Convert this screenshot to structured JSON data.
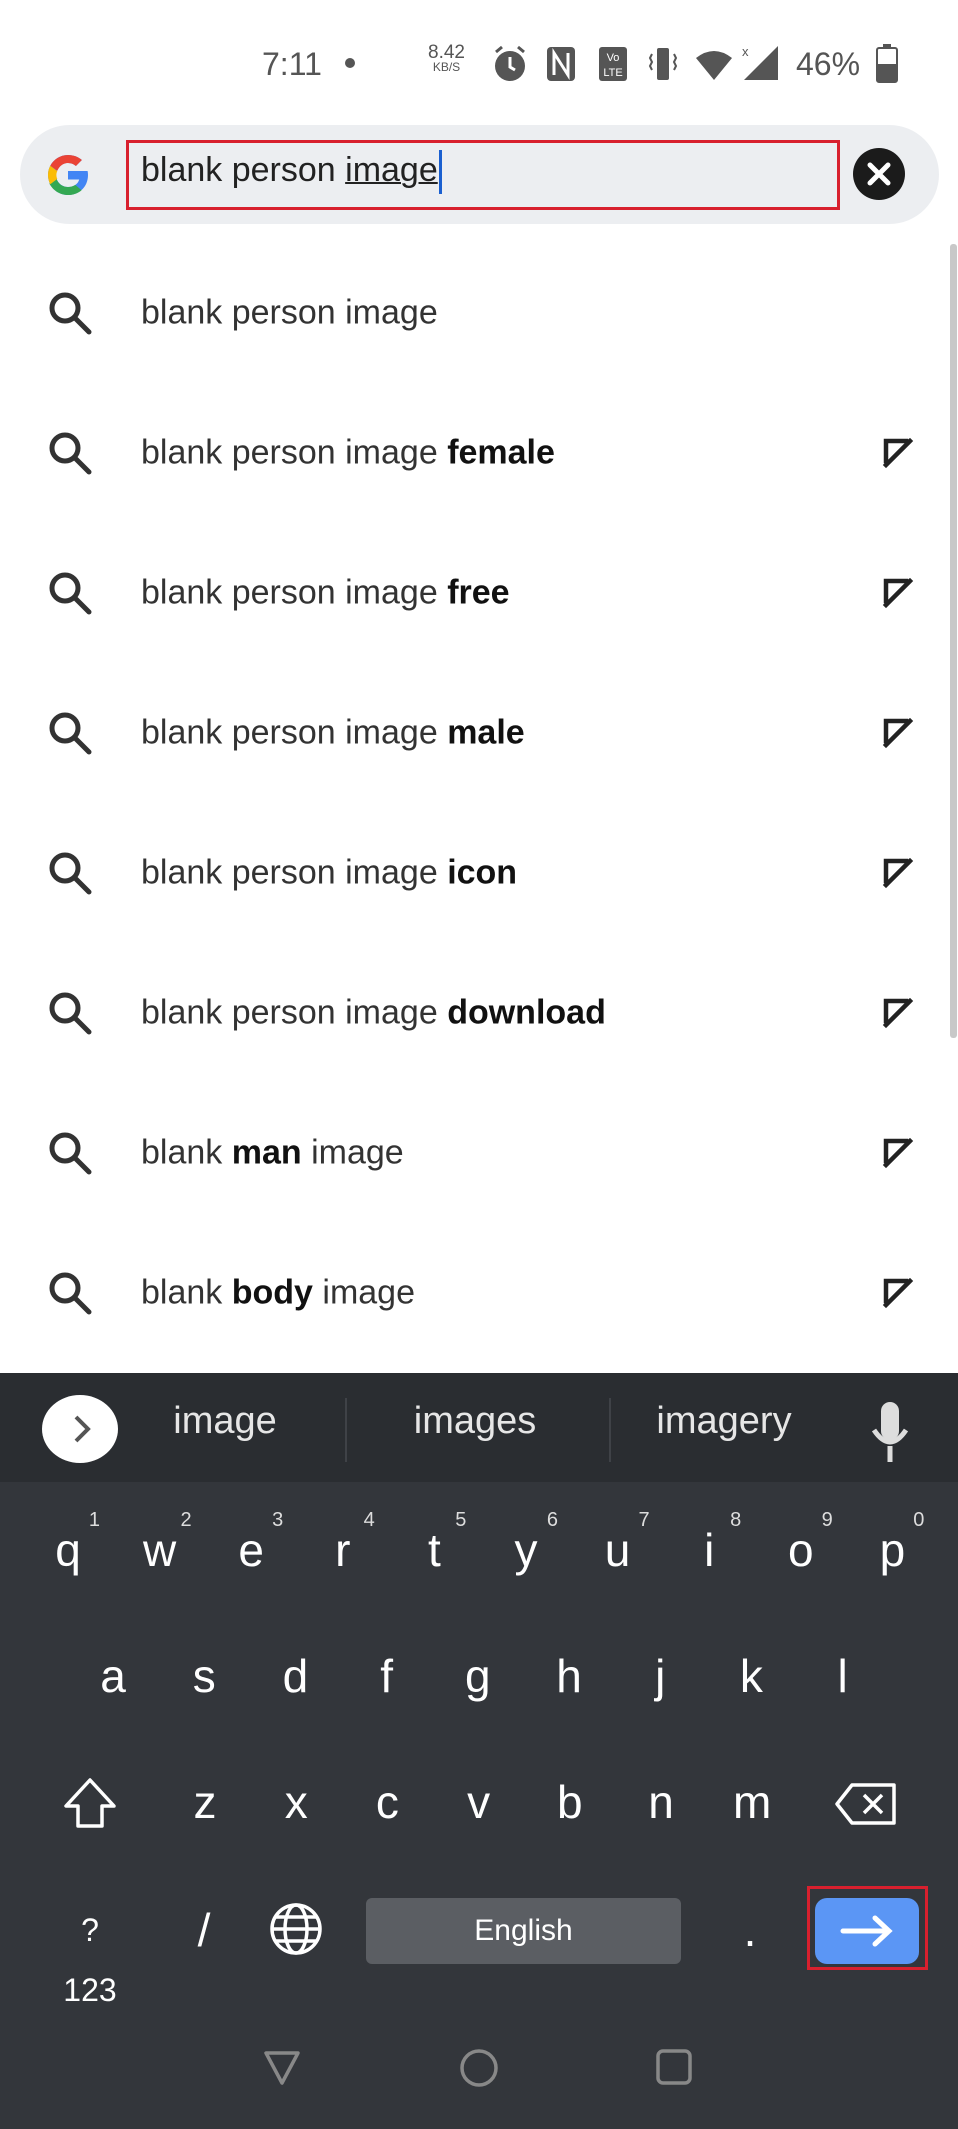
{
  "status": {
    "time": "7:11",
    "net_speed": "8.42",
    "net_unit": "KB/S",
    "battery": "46%"
  },
  "search": {
    "query_plain": "blank person ",
    "query_composing": "image"
  },
  "suggestions": [
    {
      "prefix": "blank person image",
      "bold": "",
      "suffix": ""
    },
    {
      "prefix": "blank person image ",
      "bold": "female",
      "suffix": ""
    },
    {
      "prefix": "blank person image ",
      "bold": "free",
      "suffix": ""
    },
    {
      "prefix": "blank person image ",
      "bold": "male",
      "suffix": ""
    },
    {
      "prefix": "blank person image ",
      "bold": "icon",
      "suffix": ""
    },
    {
      "prefix": "blank person image ",
      "bold": "download",
      "suffix": ""
    },
    {
      "prefix": "blank ",
      "bold": "man",
      "suffix": " image"
    },
    {
      "prefix": "blank ",
      "bold": "body",
      "suffix": " image"
    }
  ],
  "keyboard": {
    "word_suggestions": [
      "image",
      "images",
      "imagery"
    ],
    "row1": [
      [
        "q",
        "1"
      ],
      [
        "w",
        "2"
      ],
      [
        "e",
        "3"
      ],
      [
        "r",
        "4"
      ],
      [
        "t",
        "5"
      ],
      [
        "y",
        "6"
      ],
      [
        "u",
        "7"
      ],
      [
        "i",
        "8"
      ],
      [
        "o",
        "9"
      ],
      [
        "p",
        "0"
      ]
    ],
    "row2": [
      "a",
      "s",
      "d",
      "f",
      "g",
      "h",
      "j",
      "k",
      "l"
    ],
    "row3": [
      "z",
      "x",
      "c",
      "v",
      "b",
      "n",
      "m"
    ],
    "symbols_label": "?123",
    "slash": "/",
    "space_label": "English",
    "period": ".",
    "enter_color": "#5b96f5"
  },
  "colors": {
    "highlight": "#d8202e",
    "keyboard_bg": "#33363b"
  }
}
